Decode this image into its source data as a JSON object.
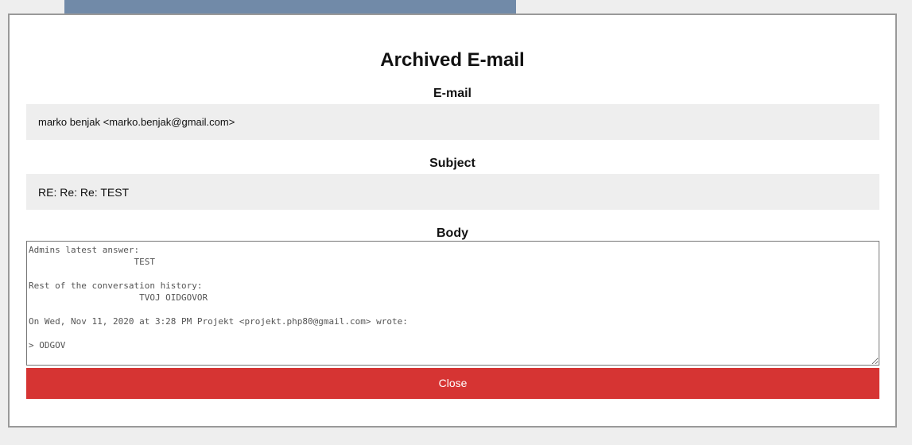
{
  "modal": {
    "title": "Archived E-mail",
    "email_label": "E-mail",
    "email_value": "marko benjak <marko.benjak@gmail.com>",
    "subject_label": "Subject",
    "subject_value": "RE: Re: Re: TEST",
    "body_label": "Body",
    "body_value": "Admins latest answer:\n                    TEST\n\nRest of the conversation history:\n                     TVOJ OIDGOVOR\n\nOn Wed, Nov 11, 2020 at 3:28 PM Projekt <projekt.php80@gmail.com> wrote:\n\n> ODGOV",
    "close_label": "Close"
  },
  "colors": {
    "backdrop": "#eeeeee",
    "header_tab": "#718aa8",
    "field_background": "#eeeeee",
    "close_button": "#d63433"
  }
}
